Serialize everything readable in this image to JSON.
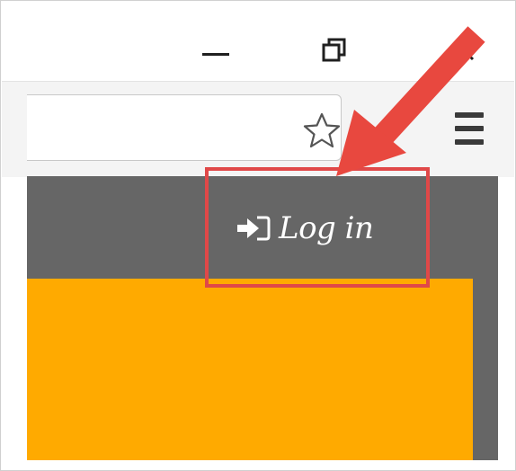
{
  "window": {
    "controls": {
      "minimize_icon": "minimize-icon",
      "restore_icon": "restore-icon",
      "close_icon": "close-icon"
    }
  },
  "toolbar": {
    "bookmark_icon": "star-icon",
    "menu_icon": "hamburger-menu-icon"
  },
  "page": {
    "login": {
      "icon": "sign-in-icon",
      "label": "Log in"
    }
  },
  "colors": {
    "page_background": "#666666",
    "banner": "#ffaa00",
    "highlight": "#e04848",
    "arrow": "#e8483f"
  }
}
